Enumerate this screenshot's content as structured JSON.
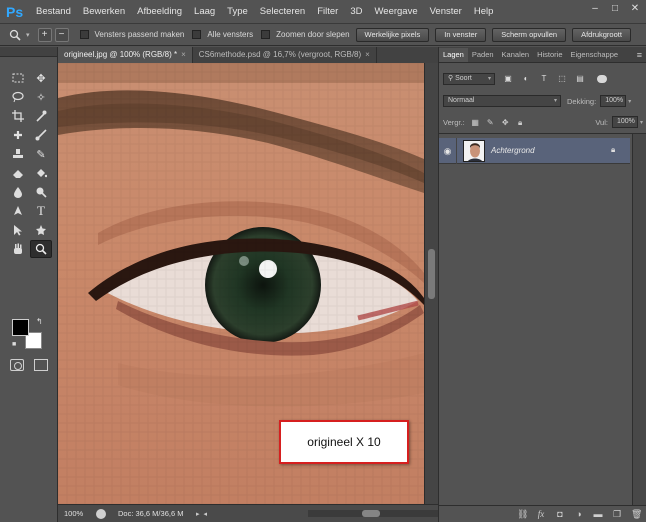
{
  "app": {
    "logo": "Ps"
  },
  "menu": [
    "Bestand",
    "Bewerken",
    "Afbeelding",
    "Laag",
    "Type",
    "Selecteren",
    "Filter",
    "3D",
    "Weergave",
    "Venster",
    "Help"
  ],
  "window_controls": {
    "minimize": "–",
    "restore": "□",
    "close": "✕"
  },
  "options_bar": {
    "resize_windows_label": "Vensters passend maken",
    "all_windows_label": "Alle vensters",
    "scrubby_zoom_label": "Zoomen door slepen",
    "actual_pixels_label": "Werkelijke pixels",
    "fit_screen_label": "In venster",
    "fill_screen_label": "Scherm opvullen",
    "print_size_label": "Afdrukgroott"
  },
  "tabs": [
    {
      "label": "origineel.jpg @ 100% (RGB/8) *",
      "close": "×"
    },
    {
      "label": "CS6methode.psd @ 16,7% (vergroot, RGB/8)",
      "close": "×"
    }
  ],
  "canvas": {
    "caption": "origineel X 10"
  },
  "status": {
    "zoom": "100%",
    "doc": "Doc: 36,6 M/36,6 M"
  },
  "panel": {
    "tabs": [
      "Lagen",
      "Paden",
      "Kanalen",
      "Historie",
      "Eigenschappe"
    ],
    "filter_kind": "Soort",
    "blend_mode": "Normaal",
    "opacity_label": "Dekking:",
    "opacity_value": "100%",
    "lock_label": "Vergr.:",
    "fill_label": "Vul:",
    "fill_value": "100%",
    "layers": [
      {
        "name": "Achtergrond"
      }
    ]
  }
}
